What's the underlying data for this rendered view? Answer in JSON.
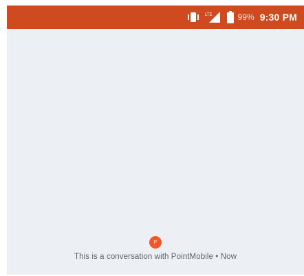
{
  "status_bar": {
    "battery_percent": "99%",
    "time": "9:30 PM",
    "icons": [
      "vibrate-icon",
      "lte-signal-icon",
      "battery-icon"
    ],
    "background_color": "#cf4a1e",
    "signal_label": "LTE"
  },
  "conversation": {
    "avatar_initial": "P",
    "avatar_color": "#f0572a",
    "info_text": "This is a conversation with PointMobile • Now"
  }
}
